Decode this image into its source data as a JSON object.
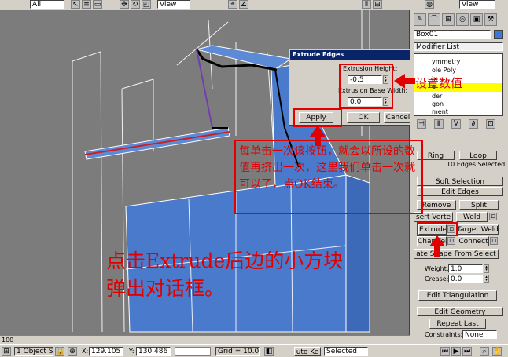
{
  "toolbar": {
    "selection_filter": "All",
    "view_dropdown": "View",
    "right_view_dropdown": "View"
  },
  "panel": {
    "object_name": "Box01",
    "modifier_list": "Modifier List",
    "stack_items": [
      "ymmetry",
      "ole Poly",
      "ix",
      "e",
      "der",
      "gon",
      "ment"
    ],
    "ring": "Ring",
    "loop": "Loop",
    "edges_selected": "10 Edges Selected",
    "soft_selection": "Soft Selection",
    "edit_edges": "Edit Edges",
    "remove": "Remove",
    "split": "Split",
    "insert_vertex": "sert Verte",
    "weld": "Weld",
    "extrude": "Extrude",
    "target_weld": "Target Weld",
    "chamfer": "Chamfer",
    "connect": "Connect",
    "create_shape": "ate Shape From Select",
    "weight_label": "Weight:",
    "weight_value": "1.0",
    "crease_label": "Crease:",
    "crease_value": "0.0",
    "edit_triangulation": "Edit Triangulation",
    "edit_geometry": "Edit Geometry",
    "repeat_last": "Repeat Last",
    "constraints_label": "Constraints:",
    "constraints_value": "None"
  },
  "dialog": {
    "title": "Extrude Edges",
    "height_label": "Extrusion Height:",
    "height_value": "-0.5",
    "base_width_label": "Extrusion Base Width:",
    "base_width_value": "0.0",
    "apply": "Apply",
    "ok": "OK",
    "cancel": "Cancel"
  },
  "annotations": {
    "set_value": "设置数值",
    "apply_note": "每单击一次该按钮，就会以所设的数值再挤出一次，这里我们单击一次就可以了，点OK结束。",
    "main_note_line1": "点击Extrude后边的小方块",
    "main_note_line2": "弹出对话框。"
  },
  "statusbar": {
    "frame": "100",
    "object_count": "1 Object S",
    "x_label": "X:",
    "x_value": "129.105",
    "y_label": "Y:",
    "y_value": "130.486",
    "grid": "Grid = 10.0",
    "auto_key": "uto Ke",
    "selected": "Selected"
  },
  "colors": {
    "viewport": "#7c7c7c",
    "mesh_blue": "#4a7acc",
    "annotation_red": "#e00000",
    "ui_gray": "#d4d0c8",
    "dialog_title": "#0a246a"
  }
}
